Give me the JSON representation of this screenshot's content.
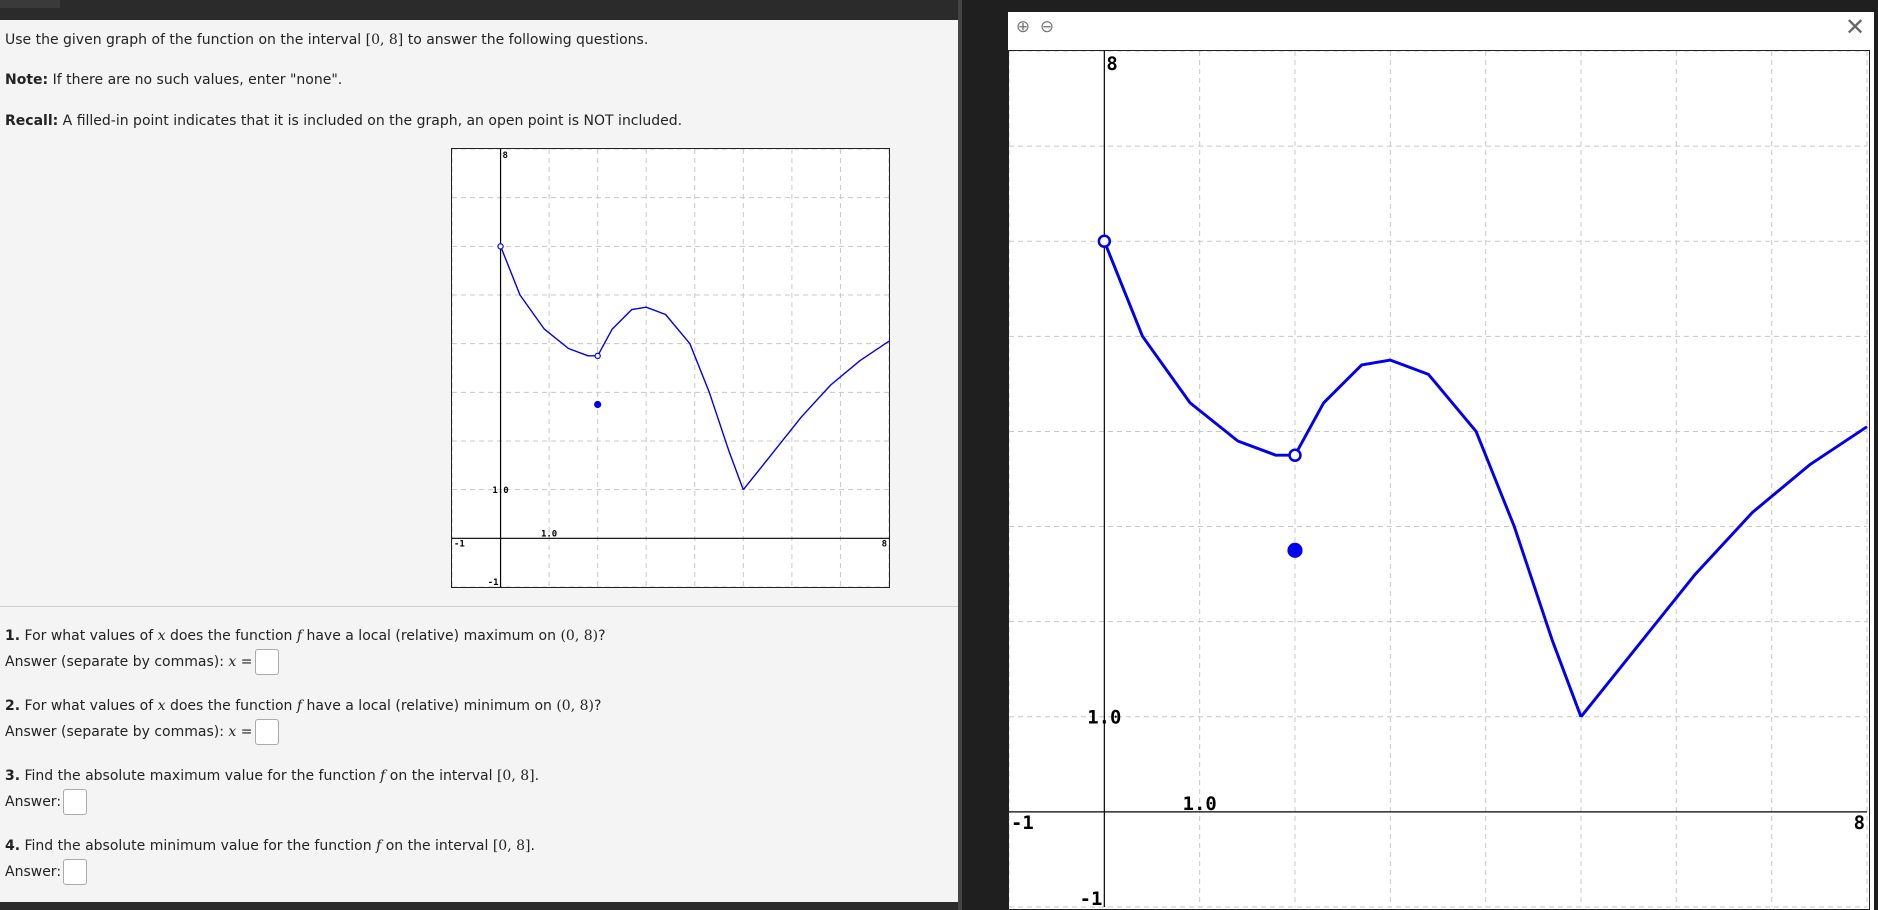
{
  "intro": {
    "line1_pre": "Use the given graph of the function on the interval ",
    "line1_interval": "[0, 8]",
    "line1_post": " to answer the following questions.",
    "note_label": "Note:",
    "note_text": " If there are no such values, enter \"none\".",
    "recall_label": "Recall:",
    "recall_text": " A filled-in point indicates that it is included on the graph, an open point is NOT included."
  },
  "questions": [
    {
      "num": "1.",
      "pre": " For what values of ",
      "var": "x",
      "mid": " does the function ",
      "fn": "f",
      "post": " have a local (relative) maximum on ",
      "interval": "(0, 8)",
      "end": "?",
      "answer_label": "Answer (separate by commas): ",
      "answer_var": "x",
      "answer_eq": " ="
    },
    {
      "num": "2.",
      "pre": " For what values of ",
      "var": "x",
      "mid": " does the function ",
      "fn": "f",
      "post": " have a local (relative) minimum on ",
      "interval": "(0, 8)",
      "end": "?",
      "answer_label": "Answer (separate by commas): ",
      "answer_var": "x",
      "answer_eq": " ="
    },
    {
      "num": "3.",
      "pre": " Find the absolute maximum value for the function ",
      "fn": "f",
      "post": " on the interval ",
      "interval": "[0, 8]",
      "end": ".",
      "answer_label": "Answer:"
    },
    {
      "num": "4.",
      "pre": " Find the absolute minimum value for the function ",
      "fn": "f",
      "post": " on the interval ",
      "interval": "[0, 8]",
      "end": ".",
      "answer_label": "Answer:"
    }
  ],
  "viewer": {
    "zoom_in_icon": "zoom-in-icon",
    "zoom_out_icon": "zoom-out-icon",
    "close_icon": "close-icon",
    "close_glyph": "✕",
    "zoom_in_glyph": "⊕",
    "zoom_out_glyph": "⊖"
  },
  "colors": {
    "curve": "#0000ee",
    "grid": "#c8c8c8",
    "axis": "#000000"
  },
  "chart_data": {
    "type": "line",
    "title": "",
    "xlabel": "",
    "ylabel": "",
    "xlim": [
      -1,
      8
    ],
    "ylim": [
      -1,
      8
    ],
    "grid": true,
    "tick_labels": {
      "x_min": "-1",
      "x_max": "8",
      "y_max": "8",
      "y_min": "-1",
      "x_one": "1.0",
      "y_one": "1.0"
    },
    "series": [
      {
        "x": [
          0,
          0.4,
          0.9,
          1.4,
          1.8,
          2.0
        ],
        "y": [
          6.0,
          5.0,
          4.3,
          3.9,
          3.75,
          3.75
        ]
      },
      {
        "x": [
          2.0,
          2.3,
          2.7,
          3.0,
          3.4,
          3.9,
          4.3,
          4.7,
          5.0
        ],
        "y": [
          3.75,
          4.3,
          4.7,
          4.75,
          4.6,
          4.0,
          3.0,
          1.8,
          1.0
        ]
      },
      {
        "x": [
          5.0,
          5.6,
          6.2,
          6.8,
          7.4,
          8.0
        ],
        "y": [
          1.0,
          1.75,
          2.5,
          3.15,
          3.65,
          4.05
        ]
      }
    ],
    "points": [
      {
        "x": 0,
        "y": 6.0,
        "filled": false
      },
      {
        "x": 2,
        "y": 3.75,
        "filled": false
      },
      {
        "x": 2,
        "y": 2.75,
        "filled": true
      }
    ]
  }
}
